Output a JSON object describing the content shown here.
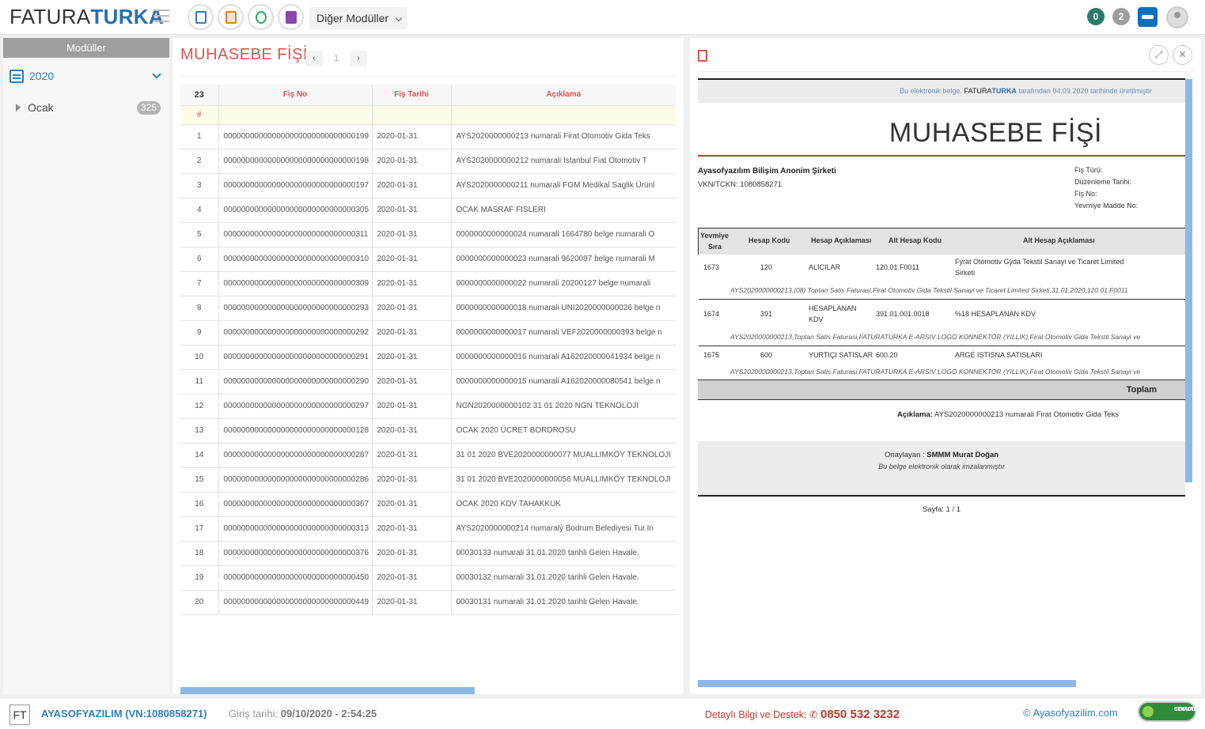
{
  "app": {
    "logo_left": "FATURA",
    "logo_right": "TURKA"
  },
  "header": {
    "modules_dropdown": "Diğer Modüller",
    "badges": [
      {
        "value": "0",
        "color": "#2a7a6b"
      },
      {
        "value": "2",
        "color": "#9e9e9e"
      }
    ],
    "module_icons": [
      {
        "name": "document-icon",
        "color": "#2e7fc2"
      },
      {
        "name": "invoice-icon",
        "color": "#e67e22"
      },
      {
        "name": "network-icon",
        "color": "#27ae60"
      },
      {
        "name": "book-icon",
        "color": "#8e44ad"
      }
    ]
  },
  "sidebar": {
    "title": "Modüller",
    "year": "2020",
    "months": [
      {
        "label": "Ocak",
        "count": "325"
      }
    ]
  },
  "main": {
    "title": "MUHASEBE FİŞİ",
    "pagination": {
      "prev": "‹",
      "page": "1",
      "next": "›"
    },
    "table": {
      "count": "23",
      "columns": [
        "Fiş No",
        "Fiş Tarihi",
        "Açıklama"
      ],
      "filter_marker": "#",
      "rows": [
        {
          "n": "1",
          "fis_no": "000000000000000000000000000000199",
          "tarih": "2020-01-31",
          "aciklama": "AYS2020000000213 numarali Firat Otomotiv Gida Teks"
        },
        {
          "n": "2",
          "fis_no": "000000000000000000000000000000198",
          "tarih": "2020-01-31",
          "aciklama": "AYS2020000000212 numarali Istanbul Fiat Otomotiv T"
        },
        {
          "n": "3",
          "fis_no": "000000000000000000000000000000197",
          "tarih": "2020-01-31",
          "aciklama": "AYS2020000000211 numarali FGM Medikal Saglik Ürünl"
        },
        {
          "n": "4",
          "fis_no": "000000000000000000000000000000305",
          "tarih": "2020-01-31",
          "aciklama": "OCAK MASRAF FISLERI"
        },
        {
          "n": "5",
          "fis_no": "000000000000000000000000000000311",
          "tarih": "2020-01-31",
          "aciklama": "0000000000000024 numarali 1664780 belge numarali O"
        },
        {
          "n": "6",
          "fis_no": "000000000000000000000000000000310",
          "tarih": "2020-01-31",
          "aciklama": "0000000000000023 numarali 9620097 belge numarali M"
        },
        {
          "n": "7",
          "fis_no": "000000000000000000000000000000309",
          "tarih": "2020-01-31",
          "aciklama": "0000000000000022 numarali 20200127 belge numarali"
        },
        {
          "n": "8",
          "fis_no": "000000000000000000000000000000293",
          "tarih": "2020-01-31",
          "aciklama": "0000000000000018 numarali UNI2020000000026 belge n"
        },
        {
          "n": "9",
          "fis_no": "000000000000000000000000000000292",
          "tarih": "2020-01-31",
          "aciklama": "0000000000000017 numarali VEF2020000000393 belge n"
        },
        {
          "n": "10",
          "fis_no": "000000000000000000000000000000291",
          "tarih": "2020-01-31",
          "aciklama": "0000000000000016 numarali A162020000041934 belge n"
        },
        {
          "n": "11",
          "fis_no": "000000000000000000000000000000290",
          "tarih": "2020-01-31",
          "aciklama": "0000000000000015 numarali A162020000080541 belge n"
        },
        {
          "n": "12",
          "fis_no": "000000000000000000000000000000297",
          "tarih": "2020-01-31",
          "aciklama": "NGN2020000000102 31 01 2020 NGN TEKNOLOJI"
        },
        {
          "n": "13",
          "fis_no": "000000000000000000000000000000128",
          "tarih": "2020-01-31",
          "aciklama": "OCAK 2020 ÜCRET BORDROSU"
        },
        {
          "n": "14",
          "fis_no": "000000000000000000000000000000287",
          "tarih": "2020-01-31",
          "aciklama": "31 01 2020 BVE2020000000077 MUALLIMKÖY TEKNOLOJI"
        },
        {
          "n": "15",
          "fis_no": "000000000000000000000000000000286",
          "tarih": "2020-01-31",
          "aciklama": "31 01 2020 BVE2020000000056 MUALLIMKÖY TEKNOLOJI"
        },
        {
          "n": "16",
          "fis_no": "000000000000000000000000000000367",
          "tarih": "2020-01-31",
          "aciklama": "OCAK 2020 KDV TAHAKKUK"
        },
        {
          "n": "17",
          "fis_no": "000000000000000000000000000000313",
          "tarih": "2020-01-31",
          "aciklama": "AYS2020000000214 numaralý Bodrum Belediyesi Tur.In"
        },
        {
          "n": "18",
          "fis_no": "000000000000000000000000000000376",
          "tarih": "2020-01-31",
          "aciklama": "00030133 numarali 31.01.2020 tarihli Gelen Havale."
        },
        {
          "n": "19",
          "fis_no": "000000000000000000000000000000450",
          "tarih": "2020-01-31",
          "aciklama": "00030132 numarali 31.01.2020 tarihli Gelen Havale."
        },
        {
          "n": "20",
          "fis_no": "000000000000000000000000000000449",
          "tarih": "2020-01-31",
          "aciklama": "00030131 numarali 31.01.2020 tarihli Gelen Havale."
        }
      ]
    }
  },
  "preview": {
    "banner_pre": "Bu elektronik belge,",
    "banner_brand_a": "FATURA",
    "banner_brand_b": "TURKA",
    "banner_post": "tarafından 04.09.2020 tarihinde üretilmiştir",
    "title": "MUHASEBE FİŞİ",
    "company": "Ayasofyazılım Bilişim Anonim Şirketi",
    "vkn": "VKN/TCKN: 1080858271",
    "meta": [
      "Fiş Türü:",
      "Düzenleme Tarihi:",
      "Fiş No:",
      "Yevmiye Madde No:"
    ],
    "line_headers": {
      "yevmiye": "Yevmiye",
      "sira": "Sıra",
      "hesap_kodu": "Hesap Kodu",
      "hesap_aciklamasi": "Hesap Açıklaması",
      "alt_hesap_kodu": "Alt Hesap Kodu",
      "alt_hesap_aciklamasi": "Alt Hesap Açıklaması"
    },
    "lines": [
      {
        "sira": "1673",
        "kod": "120",
        "aciklama": "ALICILAR",
        "aciklama2": "",
        "alt_kod": "120.01.F0011",
        "alt_aciklama": "Fýrat Otomotiv Gýda Tekstil Sanayi ve Ticaret Limited",
        "alt_aciklama2": "Sirketi",
        "detay": "AYS2020000000213,(08) Toptan Satis Faturasi,Firat Otomotiv Gida Tekstil Sanayi ve Ticaret Limited Sirketi,31.01.2020,120.01.F0011"
      },
      {
        "sira": "1674",
        "kod": "391",
        "aciklama": "HESAPLANAN",
        "aciklama2": "KDV",
        "alt_kod": "391.01.001.0018",
        "alt_aciklama": "%18 HESAPLANAN KDV",
        "alt_aciklama2": "",
        "detay": "AYS2020000000213,Toptan Satis Faturasi,FATURATURKA E-ARSIV LOGO KONNEKTÖR (YILLIK),Firat Otomotiv Gida Tekstil Sanayi ve"
      },
      {
        "sira": "1675",
        "kod": "600",
        "aciklama": "YURTIÇI SATISLAR",
        "aciklama2": "",
        "alt_kod": "600.20",
        "alt_aciklama": "ARGE ISTISNA SATISLARI",
        "alt_aciklama2": "",
        "detay": "AYS2020000000213,Toptan Satis Faturasi,FATURATURKA E-ARSIV LOGO KONNEKTÖR (YILLIK),Firat Otomotiv Gida Tekstil Sanayi ve"
      }
    ],
    "toplam": "Toplam",
    "aciklama_label": "Açıklama:",
    "aciklama_value": "AYS2020000000213 numarali Firat Otomotiv Gida Teks",
    "onaylayan_label": "Onaylayan :",
    "onaylayan_value": "SMMM Murat Doğan",
    "imza": "Bu belge elektronik olarak imzalanmıştır",
    "sayfa": "Sayfa: 1 / 1"
  },
  "footer": {
    "ft": "FT",
    "company": "AYASOFYAZILIM (VN:1080858271)",
    "giris_label": "Giriş tarihi:",
    "giris_value": "09/10/2020 - 2:54:25",
    "destek_label": "Detaylı Bilgi ve Destek:",
    "destek_phone": "0850 532 3232",
    "copyright": "© Ayasofyazilim.com",
    "comodo_a": "COMODO",
    "comodo_b": "SECURE"
  }
}
